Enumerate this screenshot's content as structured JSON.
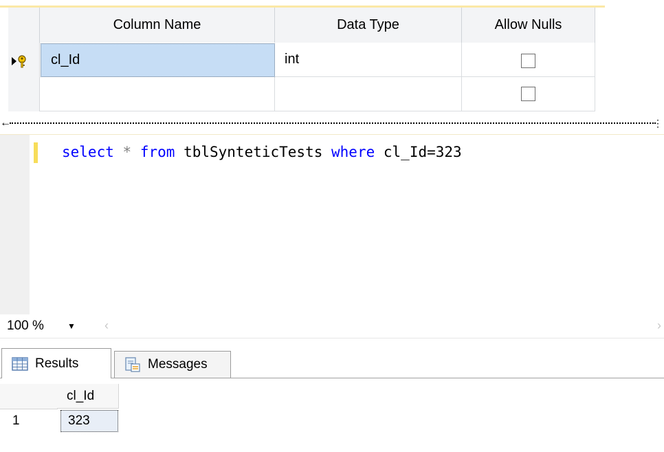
{
  "designer": {
    "columns": {
      "name_header": "Column Name",
      "type_header": "Data Type",
      "nulls_header": "Allow Nulls"
    },
    "rows": [
      {
        "name": "cl_Id",
        "type": "int",
        "allow_nulls": false,
        "primary_key": true,
        "selected": true
      },
      {
        "name": "",
        "type": "",
        "allow_nulls": false,
        "primary_key": false,
        "selected": false
      }
    ]
  },
  "editor": {
    "tokens": {
      "t1": "select",
      "t2": "*",
      "t3": "from",
      "t4": "tblSynteticTests",
      "t5": "where",
      "t6": "cl_Id=323"
    }
  },
  "zoom": {
    "value": "100 %"
  },
  "tabs": [
    {
      "label": "Results",
      "icon": "grid-icon",
      "active": true
    },
    {
      "label": "Messages",
      "icon": "messages-icon",
      "active": false
    }
  ],
  "results": {
    "column_header": "cl_Id",
    "rows": [
      {
        "row_number": "1",
        "value": "323"
      }
    ]
  },
  "colors": {
    "selected_cell": "#c6ddf5",
    "keyword": "#0000ff",
    "operator": "#808080",
    "change_bar": "#f7dd5a"
  }
}
